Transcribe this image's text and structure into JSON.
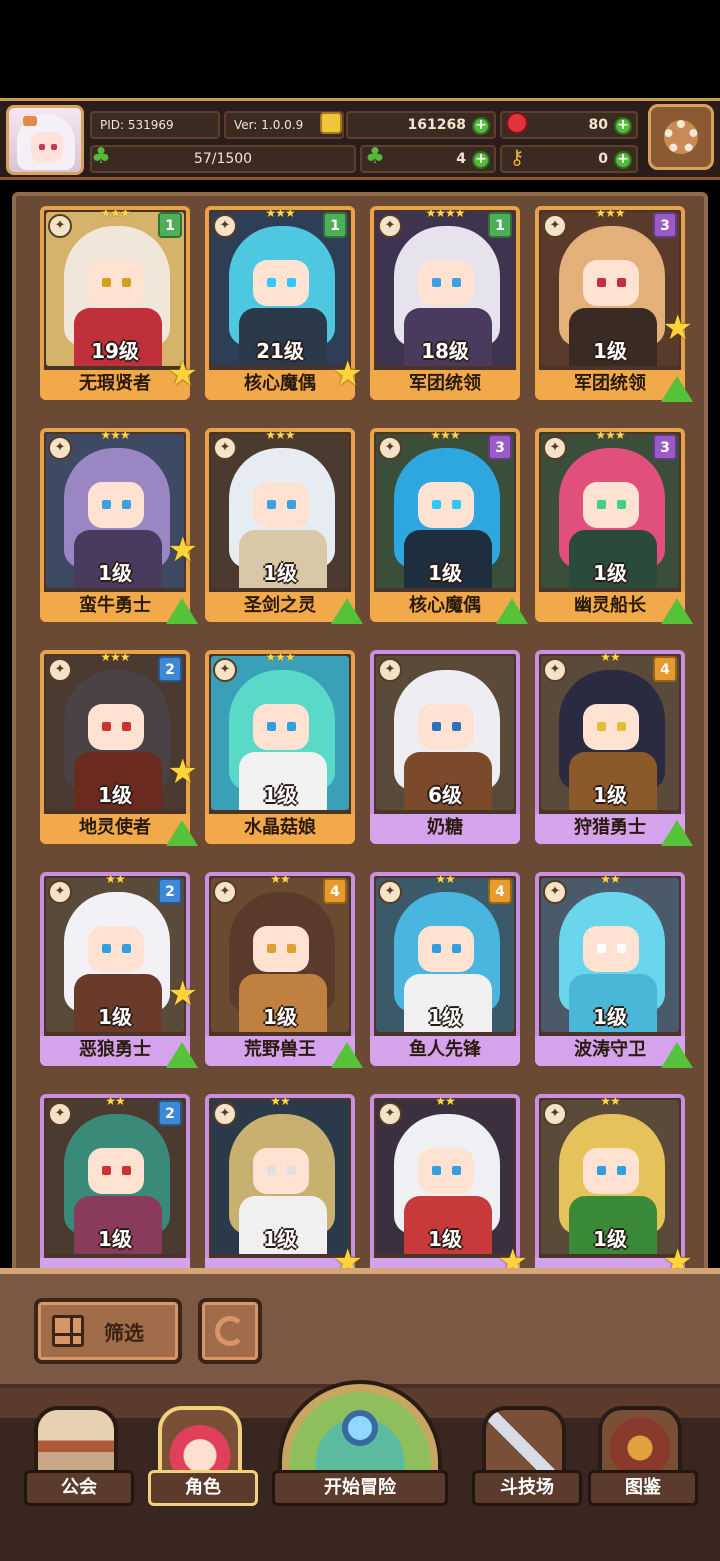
{
  "header": {
    "pid": "PID: 531969",
    "version": "Ver: 1.0.0.9",
    "coins": "161268",
    "gems": "80",
    "stamina": "57/1500",
    "clovers": "4",
    "keys": "0"
  },
  "cards": [
    {
      "name": "无瑕贤者",
      "level": "19级",
      "stars": "★★★",
      "badge": "1",
      "badge_color": "#4fae58",
      "frame": "orange",
      "star_icon": true,
      "arrow": false,
      "hair": "#f0e6da",
      "body": "#c0303a",
      "bg": "#d6b36a",
      "eye": "#d0a020"
    },
    {
      "name": "核心魔偶",
      "level": "21级",
      "stars": "★★★",
      "badge": "1",
      "badge_color": "#4fae58",
      "frame": "orange",
      "star_icon": true,
      "arrow": false,
      "hair": "#4ec8e0",
      "body": "#2a3a4a",
      "bg": "#2e3e56",
      "eye": "#30c8ff"
    },
    {
      "name": "军团统领",
      "level": "18级",
      "stars": "★★★★",
      "badge": "1",
      "badge_color": "#4fae58",
      "frame": "orange",
      "star_icon": false,
      "arrow": false,
      "hair": "#e6e2ee",
      "body": "#4a3a5e",
      "bg": "#3e3450",
      "eye": "#3ea0e0"
    },
    {
      "name": "军团统领",
      "level": "1级",
      "stars": "★★★",
      "badge": "3",
      "badge_color": "#9a5ac8",
      "frame": "orange",
      "star_icon": true,
      "arrow": true,
      "hair": "#e3b07a",
      "body": "#3a2a24",
      "bg": "#5a3a2a",
      "eye": "#c03040"
    },
    {
      "name": "蛮牛勇士",
      "level": "1级",
      "stars": "★★★",
      "badge": "",
      "badge_color": "",
      "frame": "orange",
      "star_icon": true,
      "arrow": true,
      "hair": "#9a86c2",
      "body": "#4a3a5e",
      "bg": "#3e4a64",
      "eye": "#3ea0e0"
    },
    {
      "name": "圣剑之灵",
      "level": "1级",
      "stars": "★★★",
      "badge": "",
      "badge_color": "",
      "frame": "orange",
      "star_icon": false,
      "arrow": true,
      "hair": "#e6ecf2",
      "body": "#d8c8a8",
      "bg": "#4a3a30",
      "eye": "#3ea0e0"
    },
    {
      "name": "核心魔偶",
      "level": "1级",
      "stars": "★★★",
      "badge": "3",
      "badge_color": "#9a5ac8",
      "frame": "orange",
      "star_icon": false,
      "arrow": true,
      "hair": "#2ea6e0",
      "body": "#1e2e3e",
      "bg": "#3a4e3a",
      "eye": "#30c8ff"
    },
    {
      "name": "幽灵船长",
      "level": "1级",
      "stars": "★★★",
      "badge": "3",
      "badge_color": "#9a5ac8",
      "frame": "orange",
      "star_icon": false,
      "arrow": true,
      "hair": "#e0507a",
      "body": "#2a4a3a",
      "bg": "#3a4e3a",
      "eye": "#40d080"
    },
    {
      "name": "地灵使者",
      "level": "1级",
      "stars": "★★★",
      "badge": "2",
      "badge_color": "#3e88d8",
      "frame": "orange",
      "star_icon": true,
      "arrow": true,
      "hair": "#4a4244",
      "body": "#6a2a20",
      "bg": "#4a3a30",
      "eye": "#d03030"
    },
    {
      "name": "水晶菇娘",
      "level": "1级",
      "stars": "★★★",
      "badge": "",
      "badge_color": "",
      "frame": "orange",
      "star_icon": false,
      "arrow": false,
      "hair": "#5ad8c8",
      "body": "#f2f2f2",
      "bg": "#3aa0b8",
      "eye": "#30a0e0"
    },
    {
      "name": "奶糖",
      "level": "6级",
      "stars": "",
      "badge": "",
      "badge_color": "",
      "frame": "purple",
      "star_icon": false,
      "arrow": false,
      "hair": "#eeeef2",
      "body": "#7a4a2a",
      "bg": "#5a4a3a",
      "eye": "#3070c0"
    },
    {
      "name": "狩猎勇士",
      "level": "1级",
      "stars": "★★",
      "badge": "4",
      "badge_color": "#e89a2a",
      "frame": "purple",
      "star_icon": false,
      "arrow": true,
      "hair": "#2a2a40",
      "body": "#8a5a2a",
      "bg": "#5a4a3a",
      "eye": "#e0c030"
    },
    {
      "name": "恶狼勇士",
      "level": "1级",
      "stars": "★★",
      "badge": "2",
      "badge_color": "#3e88d8",
      "frame": "purple",
      "star_icon": true,
      "arrow": true,
      "hair": "#f2f2f6",
      "body": "#6a3a2a",
      "bg": "#5a4a3a",
      "eye": "#30a0e0"
    },
    {
      "name": "荒野兽王",
      "level": "1级",
      "stars": "★★",
      "badge": "4",
      "badge_color": "#e89a2a",
      "frame": "purple",
      "star_icon": false,
      "arrow": true,
      "hair": "#5a3a2a",
      "body": "#c08040",
      "bg": "#6a4a30",
      "eye": "#e0a030"
    },
    {
      "name": "鱼人先锋",
      "level": "1级",
      "stars": "★★",
      "badge": "4",
      "badge_color": "#e89a2a",
      "frame": "purple",
      "star_icon": false,
      "arrow": false,
      "hair": "#4ab6e0",
      "body": "#f0f0f0",
      "bg": "#3a5a6a",
      "eye": "#30a0e0"
    },
    {
      "name": "波涛守卫",
      "level": "1级",
      "stars": "★★",
      "badge": "",
      "badge_color": "",
      "frame": "purple",
      "star_icon": false,
      "arrow": true,
      "hair": "#6ad6ec",
      "body": "#4ab6d8",
      "bg": "#4a5a6a",
      "eye": "#ffffff"
    },
    {
      "name": "",
      "level": "1级",
      "stars": "★★",
      "badge": "2",
      "badge_color": "#3e88d8",
      "frame": "purple",
      "star_icon": false,
      "arrow": false,
      "hair": "#3a8a7a",
      "body": "#8a3a5a",
      "bg": "#4a3a30",
      "eye": "#d03030"
    },
    {
      "name": "",
      "level": "1级",
      "stars": "★★",
      "badge": "",
      "badge_color": "",
      "frame": "purple",
      "star_icon": true,
      "arrow": false,
      "hair": "#c8b070",
      "body": "#f0f0f0",
      "bg": "#2a3a4a",
      "eye": "#e0e0e0"
    },
    {
      "name": "",
      "level": "1级",
      "stars": "★★",
      "badge": "",
      "badge_color": "",
      "frame": "purple",
      "star_icon": true,
      "arrow": false,
      "hair": "#eef0f4",
      "body": "#c83a3a",
      "bg": "#3a3040",
      "eye": "#30a0e0"
    },
    {
      "name": "",
      "level": "1级",
      "stars": "★★",
      "badge": "",
      "badge_color": "",
      "frame": "purple",
      "star_icon": true,
      "arrow": false,
      "hair": "#e6c25a",
      "body": "#3a8a3a",
      "bg": "#5a4a3a",
      "eye": "#30a0e0"
    }
  ],
  "filter": {
    "label": "筛选"
  },
  "nav": {
    "guild": "公会",
    "character": "角色",
    "adventure": "开始冒险",
    "arena": "斗技场",
    "codex": "图鉴"
  }
}
